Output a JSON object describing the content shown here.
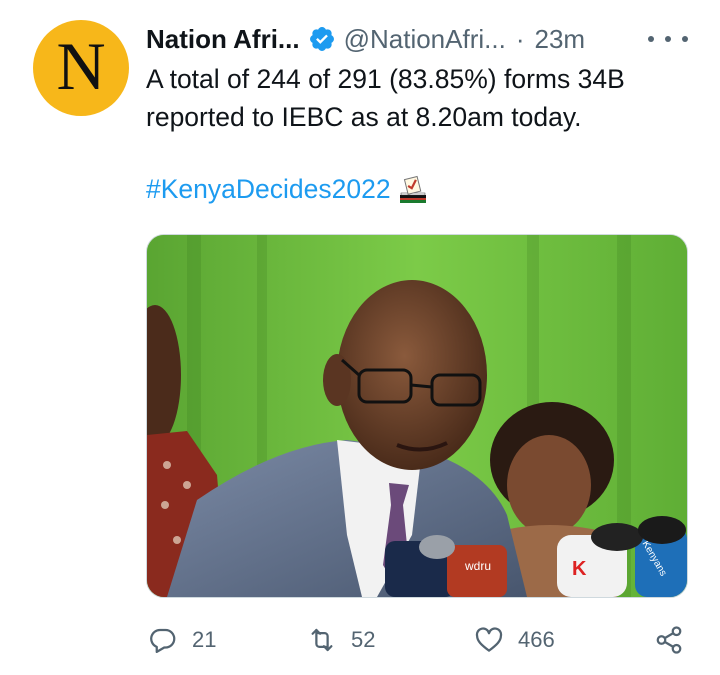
{
  "tweet": {
    "avatar_letter": "N",
    "display_name": "Nation Afri...",
    "handle": "@NationAfri...",
    "separator": "·",
    "timestamp": "23m",
    "text": "A total of 244 of 291 (83.85%) forms 34B reported to IEBC as at 8.20am today.",
    "hashtag": "#KenyaDecides2022",
    "media": {
      "microphone_brands": [
        "wdru",
        "K",
        "Kenyans"
      ]
    }
  },
  "actions": {
    "replies": "21",
    "retweets": "52",
    "likes": "466"
  },
  "colors": {
    "accent": "#1d9bf0",
    "secondary_text": "#536471",
    "avatar_bg": "#f7b71a"
  }
}
